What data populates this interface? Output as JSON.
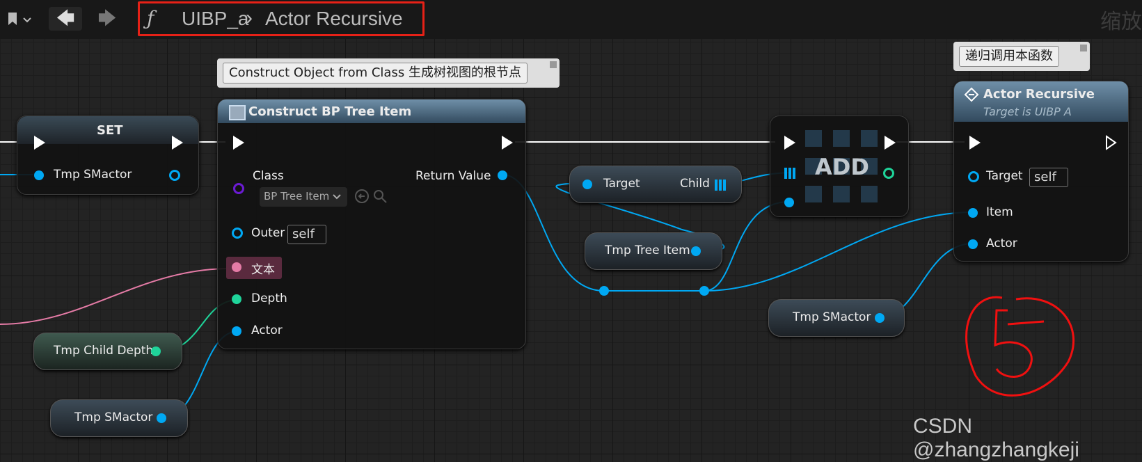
{
  "topbar": {
    "back_glyph": "🡄",
    "forward_glyph": "🡆",
    "function_glyph": "ƒ",
    "crumb_root": "UIBP_a",
    "crumb_sep": "›",
    "crumb_current": "Actor Recursive",
    "zoom_label": "缩放"
  },
  "comments": {
    "construct": "Construct Object from Class 生成树视图的根节点",
    "recursive": "递归调用本函数"
  },
  "set_node": {
    "title": "SET",
    "pin": "Tmp SMactor"
  },
  "construct_node": {
    "title": "Construct BP Tree Item",
    "class_label": "Class",
    "class_value": "BP Tree Item",
    "return_label": "Return Value",
    "outer_label": "Outer",
    "outer_value": "self",
    "text_label": "文本",
    "depth_label": "Depth",
    "actor_label": "Actor"
  },
  "target_child_node": {
    "target": "Target",
    "child": "Child"
  },
  "tmp_tree_item": "Tmp Tree Item",
  "add_node": {
    "title": "ADD"
  },
  "actor_recursive_node": {
    "title": "Actor Recursive",
    "subtitle": "Target is UIBP A",
    "target_label": "Target",
    "target_value": "self",
    "item_label": "Item",
    "actor_label": "Actor"
  },
  "vars": {
    "child_depth": "Tmp Child Depth",
    "smactor_a": "Tmp SMactor",
    "smactor_b": "Tmp SMactor"
  },
  "annotation_number": "5",
  "watermark": "CSDN @zhangzhangkeji",
  "colors": {
    "exec": "#ffffff",
    "object": "#00a8f3",
    "int": "#1fd49a",
    "text": "#e57ba6",
    "class": "#6b1bd3",
    "highlight": "#e62117"
  }
}
